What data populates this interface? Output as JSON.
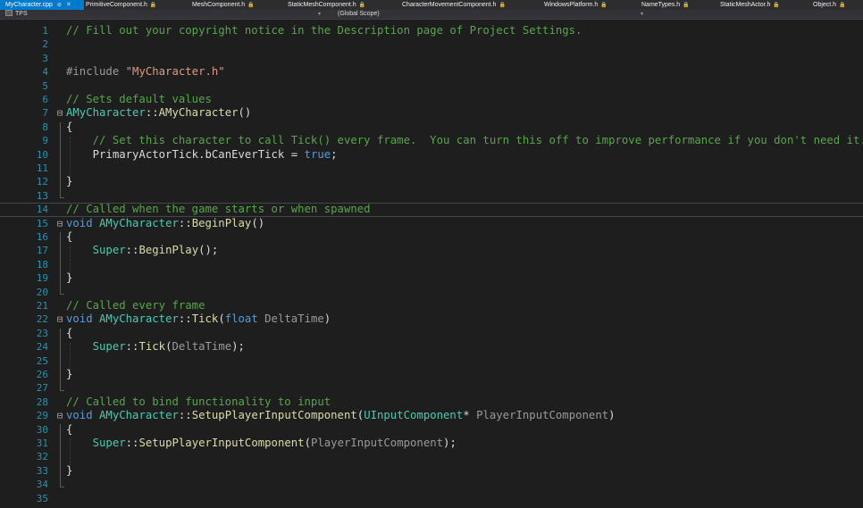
{
  "tabs": [
    {
      "label": "MyCharacter.cpp",
      "active": true,
      "marker": "⊘",
      "close": "✕"
    },
    {
      "label": "PrimitiveComponent.h",
      "lock": "🔒"
    },
    {
      "label": "MeshComponent.h",
      "lock": "🔒"
    },
    {
      "label": "StaticMeshComponent.h",
      "lock": "🔒"
    },
    {
      "label": "CharacterMovementComponent.h",
      "lock": "🔒"
    },
    {
      "label": "WindowsPlatform.h",
      "lock": "🔒"
    },
    {
      "label": "NameTypes.h",
      "lock": "🔒"
    },
    {
      "label": "StaticMeshActor.h",
      "lock": "🔒"
    },
    {
      "label": "Object.h",
      "lock": "🔒"
    }
  ],
  "navbar": {
    "project": "TPS",
    "scope": "(Global Scope)",
    "chevron": "▾"
  },
  "editor": {
    "lines": [
      {
        "n": "1",
        "tokens": [
          {
            "t": "// Fill out your copyright notice in the Description page of Project Settings.",
            "c": "comment"
          }
        ]
      },
      {
        "n": "2",
        "tokens": []
      },
      {
        "n": "3",
        "tokens": []
      },
      {
        "n": "4",
        "tokens": [
          {
            "t": "#include ",
            "c": "pre"
          },
          {
            "t": "\"MyCharacter.h\"",
            "c": "str"
          }
        ]
      },
      {
        "n": "5",
        "tokens": []
      },
      {
        "n": "6",
        "tokens": [
          {
            "t": "// Sets default values",
            "c": "comment"
          }
        ]
      },
      {
        "n": "7",
        "fold": "⊟",
        "tokens": [
          {
            "t": "AMyCharacter",
            "c": "type"
          },
          {
            "t": "::",
            "c": "text"
          },
          {
            "t": "AMyCharacter",
            "c": "fn"
          },
          {
            "t": "()",
            "c": "text"
          }
        ]
      },
      {
        "n": "8",
        "tokens": [
          {
            "t": "{",
            "c": "text"
          }
        ]
      },
      {
        "n": "9",
        "tokens": [
          {
            "t": "    // Set this character to call Tick() every frame.  You can turn this off to improve performance if you don't need it.",
            "c": "comment"
          }
        ]
      },
      {
        "n": "10",
        "tokens": [
          {
            "t": "    PrimaryActorTick",
            "c": "member"
          },
          {
            "t": ".",
            "c": "text"
          },
          {
            "t": "bCanEverTick",
            "c": "member"
          },
          {
            "t": " = ",
            "c": "text"
          },
          {
            "t": "true",
            "c": "kw"
          },
          {
            "t": ";",
            "c": "text"
          }
        ]
      },
      {
        "n": "11",
        "tokens": []
      },
      {
        "n": "12",
        "tokens": [
          {
            "t": "}",
            "c": "text"
          }
        ]
      },
      {
        "n": "13",
        "tokens": []
      },
      {
        "n": "14",
        "current": true,
        "tokens": [
          {
            "t": "// Called when the game starts or when spawned",
            "c": "comment"
          }
        ]
      },
      {
        "n": "15",
        "fold": "⊟",
        "tokens": [
          {
            "t": "void",
            "c": "kw"
          },
          {
            "t": " ",
            "c": "text"
          },
          {
            "t": "AMyCharacter",
            "c": "type"
          },
          {
            "t": "::",
            "c": "text"
          },
          {
            "t": "BeginPlay",
            "c": "fn"
          },
          {
            "t": "()",
            "c": "text"
          }
        ]
      },
      {
        "n": "16",
        "tokens": [
          {
            "t": "{",
            "c": "text"
          }
        ]
      },
      {
        "n": "17",
        "tokens": [
          {
            "t": "    ",
            "c": "text"
          },
          {
            "t": "Super",
            "c": "type"
          },
          {
            "t": "::",
            "c": "text"
          },
          {
            "t": "BeginPlay",
            "c": "fn"
          },
          {
            "t": "();",
            "c": "text"
          }
        ]
      },
      {
        "n": "18",
        "tokens": []
      },
      {
        "n": "19",
        "tokens": [
          {
            "t": "}",
            "c": "text"
          }
        ]
      },
      {
        "n": "20",
        "tokens": []
      },
      {
        "n": "21",
        "tokens": [
          {
            "t": "// Called every frame",
            "c": "comment"
          }
        ]
      },
      {
        "n": "22",
        "fold": "⊟",
        "tokens": [
          {
            "t": "void",
            "c": "kw"
          },
          {
            "t": " ",
            "c": "text"
          },
          {
            "t": "AMyCharacter",
            "c": "type"
          },
          {
            "t": "::",
            "c": "text"
          },
          {
            "t": "Tick",
            "c": "fn"
          },
          {
            "t": "(",
            "c": "text"
          },
          {
            "t": "float",
            "c": "kw"
          },
          {
            "t": " ",
            "c": "text"
          },
          {
            "t": "DeltaTime",
            "c": "param"
          },
          {
            "t": ")",
            "c": "text"
          }
        ]
      },
      {
        "n": "23",
        "tokens": [
          {
            "t": "{",
            "c": "text"
          }
        ]
      },
      {
        "n": "24",
        "tokens": [
          {
            "t": "    ",
            "c": "text"
          },
          {
            "t": "Super",
            "c": "type"
          },
          {
            "t": "::",
            "c": "text"
          },
          {
            "t": "Tick",
            "c": "fn"
          },
          {
            "t": "(",
            "c": "text"
          },
          {
            "t": "DeltaTime",
            "c": "param"
          },
          {
            "t": ");",
            "c": "text"
          }
        ]
      },
      {
        "n": "25",
        "tokens": []
      },
      {
        "n": "26",
        "tokens": [
          {
            "t": "}",
            "c": "text"
          }
        ]
      },
      {
        "n": "27",
        "tokens": []
      },
      {
        "n": "28",
        "tokens": [
          {
            "t": "// Called to bind functionality to input",
            "c": "comment"
          }
        ]
      },
      {
        "n": "29",
        "fold": "⊟",
        "tokens": [
          {
            "t": "void",
            "c": "kw"
          },
          {
            "t": " ",
            "c": "text"
          },
          {
            "t": "AMyCharacter",
            "c": "type"
          },
          {
            "t": "::",
            "c": "text"
          },
          {
            "t": "SetupPlayerInputComponent",
            "c": "fn"
          },
          {
            "t": "(",
            "c": "text"
          },
          {
            "t": "UInputComponent",
            "c": "type"
          },
          {
            "t": "* ",
            "c": "text"
          },
          {
            "t": "PlayerInputComponent",
            "c": "param"
          },
          {
            "t": ")",
            "c": "text"
          }
        ]
      },
      {
        "n": "30",
        "tokens": [
          {
            "t": "{",
            "c": "text"
          }
        ]
      },
      {
        "n": "31",
        "tokens": [
          {
            "t": "    ",
            "c": "text"
          },
          {
            "t": "Super",
            "c": "type"
          },
          {
            "t": "::",
            "c": "text"
          },
          {
            "t": "SetupPlayerInputComponent",
            "c": "fn"
          },
          {
            "t": "(",
            "c": "text"
          },
          {
            "t": "PlayerInputComponent",
            "c": "param"
          },
          {
            "t": ");",
            "c": "text"
          }
        ]
      },
      {
        "n": "32",
        "tokens": []
      },
      {
        "n": "33",
        "tokens": [
          {
            "t": "}",
            "c": "text"
          }
        ]
      },
      {
        "n": "34",
        "tokens": []
      },
      {
        "n": "35",
        "tokens": []
      }
    ]
  },
  "colors": {
    "background": "#1e1e1e",
    "line_number": "#2b91af",
    "comment": "#57a64a",
    "keyword": "#569cd6",
    "type": "#4ec9b0",
    "function": "#dcdcaa",
    "string": "#d69d85",
    "active_tab": "#007acc"
  }
}
